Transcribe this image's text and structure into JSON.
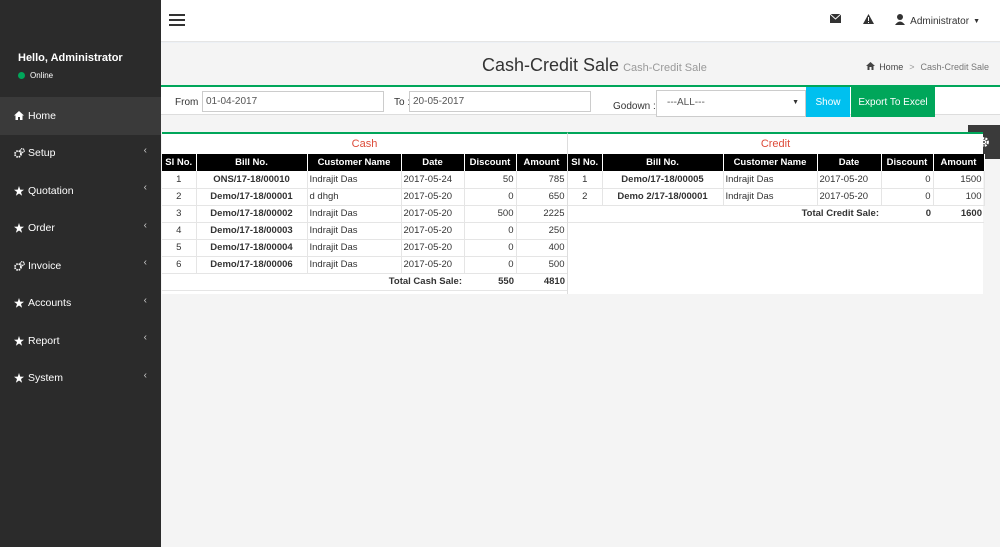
{
  "sidebar": {
    "greeting": "Hello, Administrator",
    "status": "Online",
    "items": [
      {
        "label": "Home",
        "icon": "dashboard-icon",
        "active": true,
        "chevron": false
      },
      {
        "label": "Setup",
        "icon": "cogs-icon",
        "active": false,
        "chevron": true
      },
      {
        "label": "Quotation",
        "icon": "star-icon",
        "active": false,
        "chevron": true
      },
      {
        "label": "Order",
        "icon": "star-icon",
        "active": false,
        "chevron": true
      },
      {
        "label": "Invoice",
        "icon": "cogs-icon",
        "active": false,
        "chevron": true
      },
      {
        "label": "Accounts",
        "icon": "star-icon",
        "active": false,
        "chevron": true
      },
      {
        "label": "Report",
        "icon": "star-icon",
        "active": false,
        "chevron": true
      },
      {
        "label": "System",
        "icon": "star-icon",
        "active": false,
        "chevron": true
      }
    ]
  },
  "topbar": {
    "user_label": "Administrator"
  },
  "header": {
    "title": "Cash-Credit Sale",
    "subtitle": "Cash-Credit Sale",
    "breadcrumb_home": "Home",
    "breadcrumb_current": "Cash-Credit Sale"
  },
  "filter": {
    "from_label": "From :",
    "from_value": "01-04-2017",
    "to_label": "To :",
    "to_value": "20-05-2017",
    "godown_label": "Godown :",
    "godown_value": "---ALL---",
    "show_label": "Show",
    "export_label": "Export To Excel"
  },
  "cash": {
    "title": "Cash",
    "columns": [
      "Sl No.",
      "Bill No.",
      "Customer Name",
      "Date",
      "Discount",
      "Amount"
    ],
    "rows": [
      [
        "1",
        "ONS/17-18/00010",
        "Indrajit Das",
        "2017-05-24",
        "50",
        "785"
      ],
      [
        "2",
        "Demo/17-18/00001",
        "d dhgh",
        "2017-05-20",
        "0",
        "650"
      ],
      [
        "3",
        "Demo/17-18/00002",
        "Indrajit Das",
        "2017-05-20",
        "500",
        "2225"
      ],
      [
        "4",
        "Demo/17-18/00003",
        "Indrajit Das",
        "2017-05-20",
        "0",
        "250"
      ],
      [
        "5",
        "Demo/17-18/00004",
        "Indrajit Das",
        "2017-05-20",
        "0",
        "400"
      ],
      [
        "6",
        "Demo/17-18/00006",
        "Indrajit Das",
        "2017-05-20",
        "0",
        "500"
      ]
    ],
    "total_label": "Total Cash Sale:",
    "total_discount": "550",
    "total_amount": "4810"
  },
  "credit": {
    "title": "Credit",
    "columns": [
      "Sl No.",
      "Bill No.",
      "Customer Name",
      "Date",
      "Discount",
      "Amount"
    ],
    "rows": [
      [
        "1",
        "Demo/17-18/00005",
        "Indrajit Das",
        "2017-05-20",
        "0",
        "1500"
      ],
      [
        "2",
        "Demo 2/17-18/00001",
        "Indrajit Das",
        "2017-05-20",
        "0",
        "100"
      ]
    ],
    "total_label": "Total Credit Sale:",
    "total_discount": "0",
    "total_amount": "1600"
  }
}
